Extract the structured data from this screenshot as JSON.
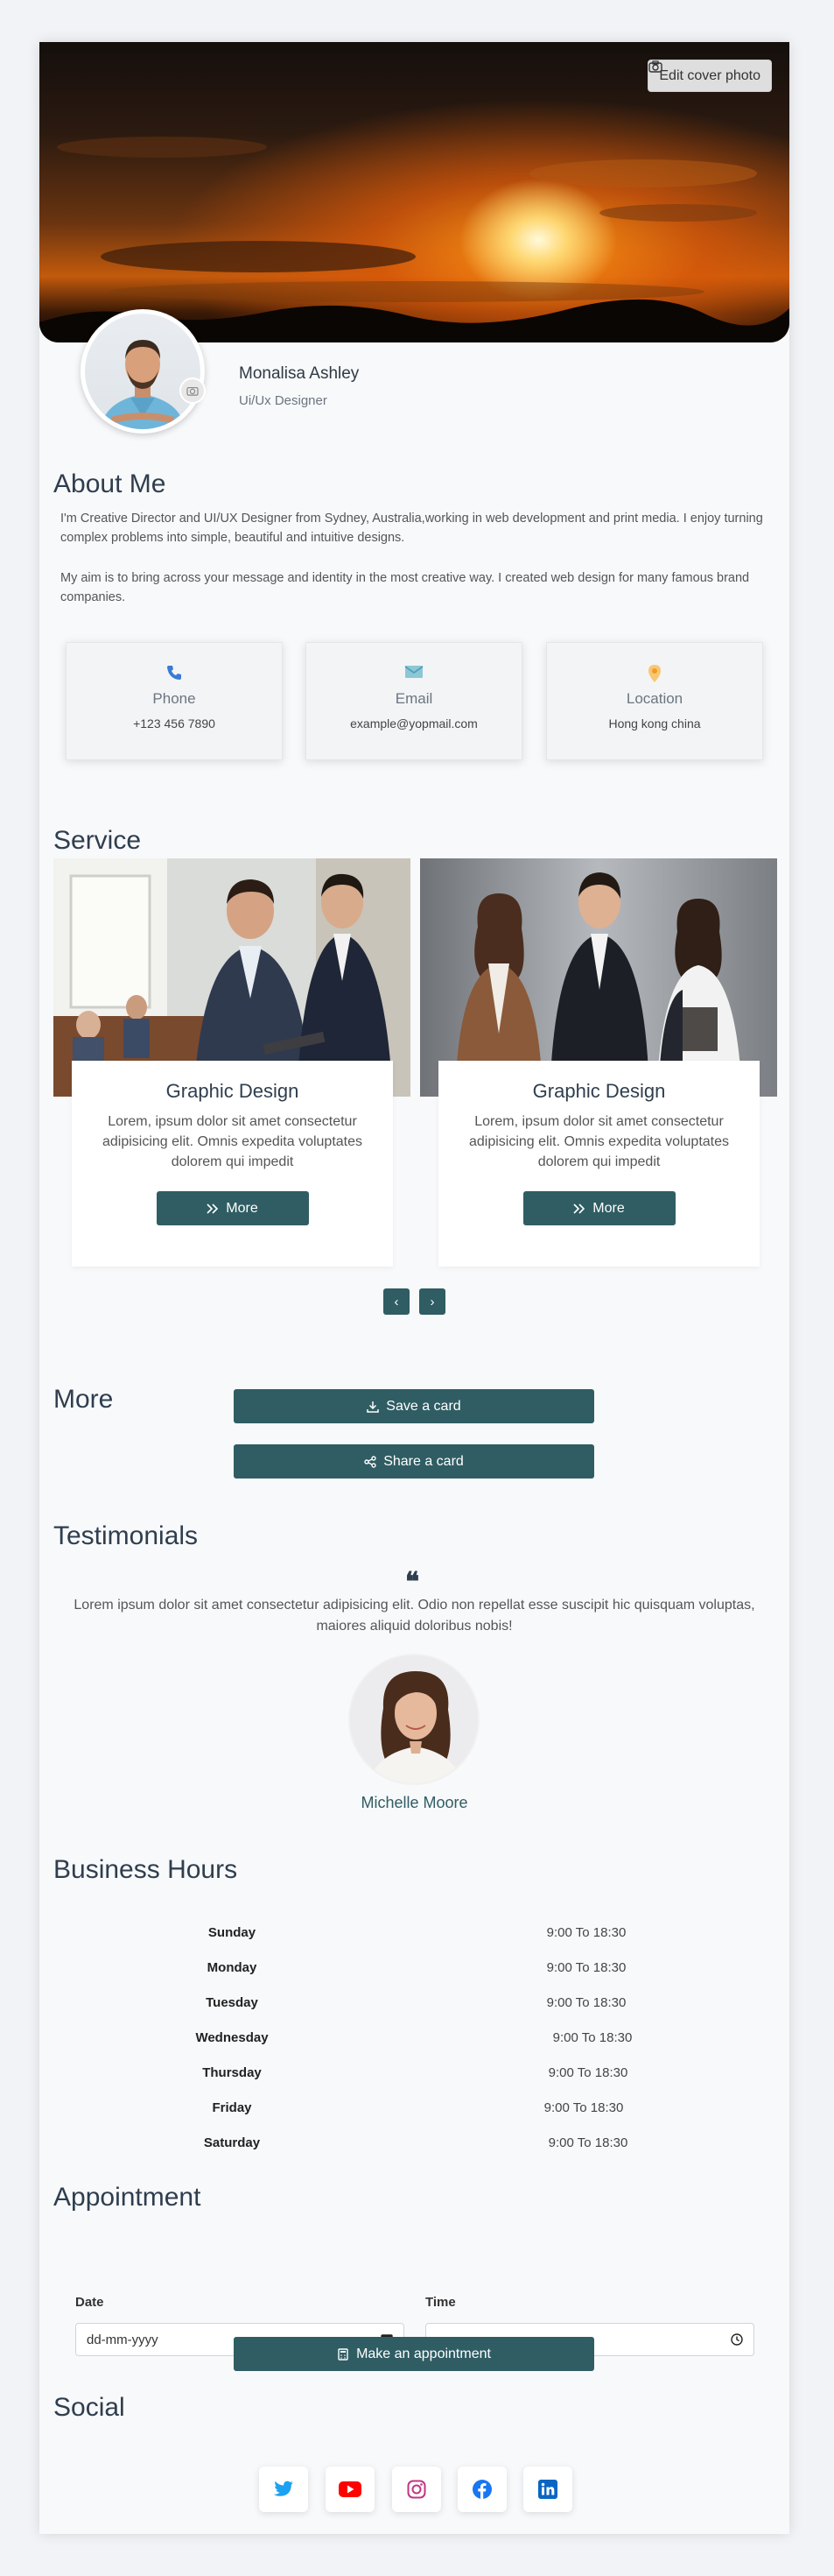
{
  "cover": {
    "edit_label": "Edit cover photo"
  },
  "profile": {
    "name": "Monalisa Ashley",
    "role": "Ui/Ux Designer"
  },
  "about": {
    "title": "About Me",
    "paragraph1": "I'm Creative Director and UI/UX Designer from Sydney, Australia,working in web development and print media. I enjoy turning complex problems into simple, beautiful and intuitive designs.",
    "paragraph2": "My aim is to bring across your message and identity in the most creative way. I created web design for many famous brand companies."
  },
  "contacts": [
    {
      "label": "Phone",
      "value": "+123 456 7890",
      "icon": "phone-icon",
      "color": "#3a7bd5"
    },
    {
      "label": "Email",
      "value": "example@yopmail.com",
      "icon": "envelope-icon",
      "color": "#5fb3c8"
    },
    {
      "label": "Location",
      "value": "Hong kong china",
      "icon": "map-pin-icon",
      "color": "#f5a623"
    }
  ],
  "service": {
    "title": "Service",
    "items": [
      {
        "title": "Graphic Design",
        "description": "Lorem, ipsum dolor sit amet consectetur adipisicing elit. Omnis expedita voluptates dolorem qui impedit",
        "button": "More"
      },
      {
        "title": "Graphic Design",
        "description": "Lorem, ipsum dolor sit amet consectetur adipisicing elit. Omnis expedita voluptates dolorem qui impedit",
        "button": "More"
      }
    ],
    "prev": "‹",
    "next": "›"
  },
  "more": {
    "title": "More",
    "save_label": "Save a card",
    "share_label": "Share a card"
  },
  "testimonials": {
    "title": "Testimonials",
    "quote": "Lorem ipsum dolor sit amet consectetur adipisicing elit. Odio non repellat esse suscipit hic quisquam voluptas, maiores aliquid doloribus nobis!",
    "name": "Michelle Moore"
  },
  "business_hours": {
    "title": "Business Hours",
    "rows": [
      {
        "day": "Sunday",
        "time": "9:00 To 18:30"
      },
      {
        "day": "Monday",
        "time": "9:00 To 18:30"
      },
      {
        "day": "Tuesday",
        "time": "9:00 To 18:30"
      },
      {
        "day": "Wednesday",
        "time": "9:00 To 18:30"
      },
      {
        "day": "Thursday",
        "time": "9:00 To 18:30"
      },
      {
        "day": "Friday",
        "time": "9:00 To 18:30"
      },
      {
        "day": "Saturday",
        "time": "9:00 To 18:30"
      }
    ]
  },
  "appointment": {
    "title": "Appointment",
    "date_label": "Date",
    "date_placeholder": "dd-mm-yyyy",
    "time_label": "Time",
    "time_placeholder": "--:--",
    "button": "Make an appointment"
  },
  "social": {
    "title": "Social",
    "items": [
      {
        "icon": "twitter-icon",
        "color": "#1da1f2"
      },
      {
        "icon": "youtube-icon",
        "color": "#ff0000"
      },
      {
        "icon": "instagram-icon",
        "color": "#c13584"
      },
      {
        "icon": "facebook-icon",
        "color": "#1877f2"
      },
      {
        "icon": "linkedin-icon",
        "color": "#0a66c2"
      }
    ]
  },
  "colors": {
    "accent": "#2f5d63",
    "heading": "#2f3e4e",
    "background": "#f8f9fb"
  }
}
